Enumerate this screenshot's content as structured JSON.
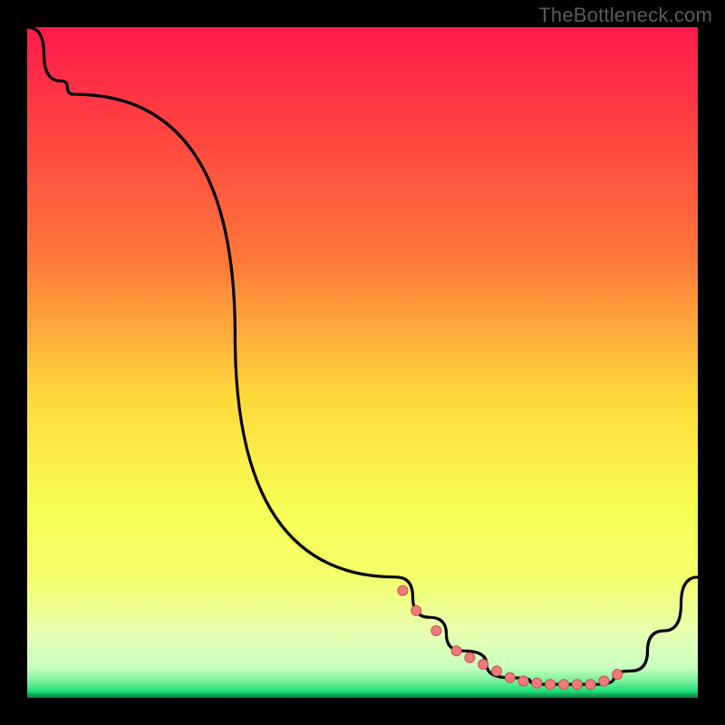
{
  "watermark": "TheBottleneck.com",
  "colors": {
    "bg": "#000000",
    "top": "#ff1a4b",
    "upper_mid": "#ff7a3a",
    "mid": "#ffd93a",
    "lower_mid": "#f3ff6a",
    "pale": "#e9ffb0",
    "green": "#1ee07a",
    "curve": "#000000",
    "marker_fill": "#f07a7a",
    "marker_stroke": "#c94f4f"
  },
  "chart_data": {
    "type": "line",
    "title": "",
    "xlabel": "",
    "ylabel": "",
    "xlim": [
      0,
      100
    ],
    "ylim": [
      0,
      100
    ],
    "curve": {
      "x": [
        0,
        5,
        7,
        55,
        60,
        65,
        72,
        78,
        85,
        90,
        95,
        100
      ],
      "y": [
        100,
        92,
        90,
        18,
        12,
        7,
        3,
        2,
        2,
        4,
        10,
        18
      ]
    },
    "markers": {
      "x": [
        56,
        58,
        61,
        64,
        66,
        68,
        70,
        72,
        74,
        76,
        78,
        80,
        82,
        84,
        86,
        88
      ],
      "y": [
        16,
        13,
        10,
        7,
        6,
        5,
        4,
        3,
        2.5,
        2.2,
        2,
        2,
        2,
        2,
        2.5,
        3.5
      ]
    }
  }
}
